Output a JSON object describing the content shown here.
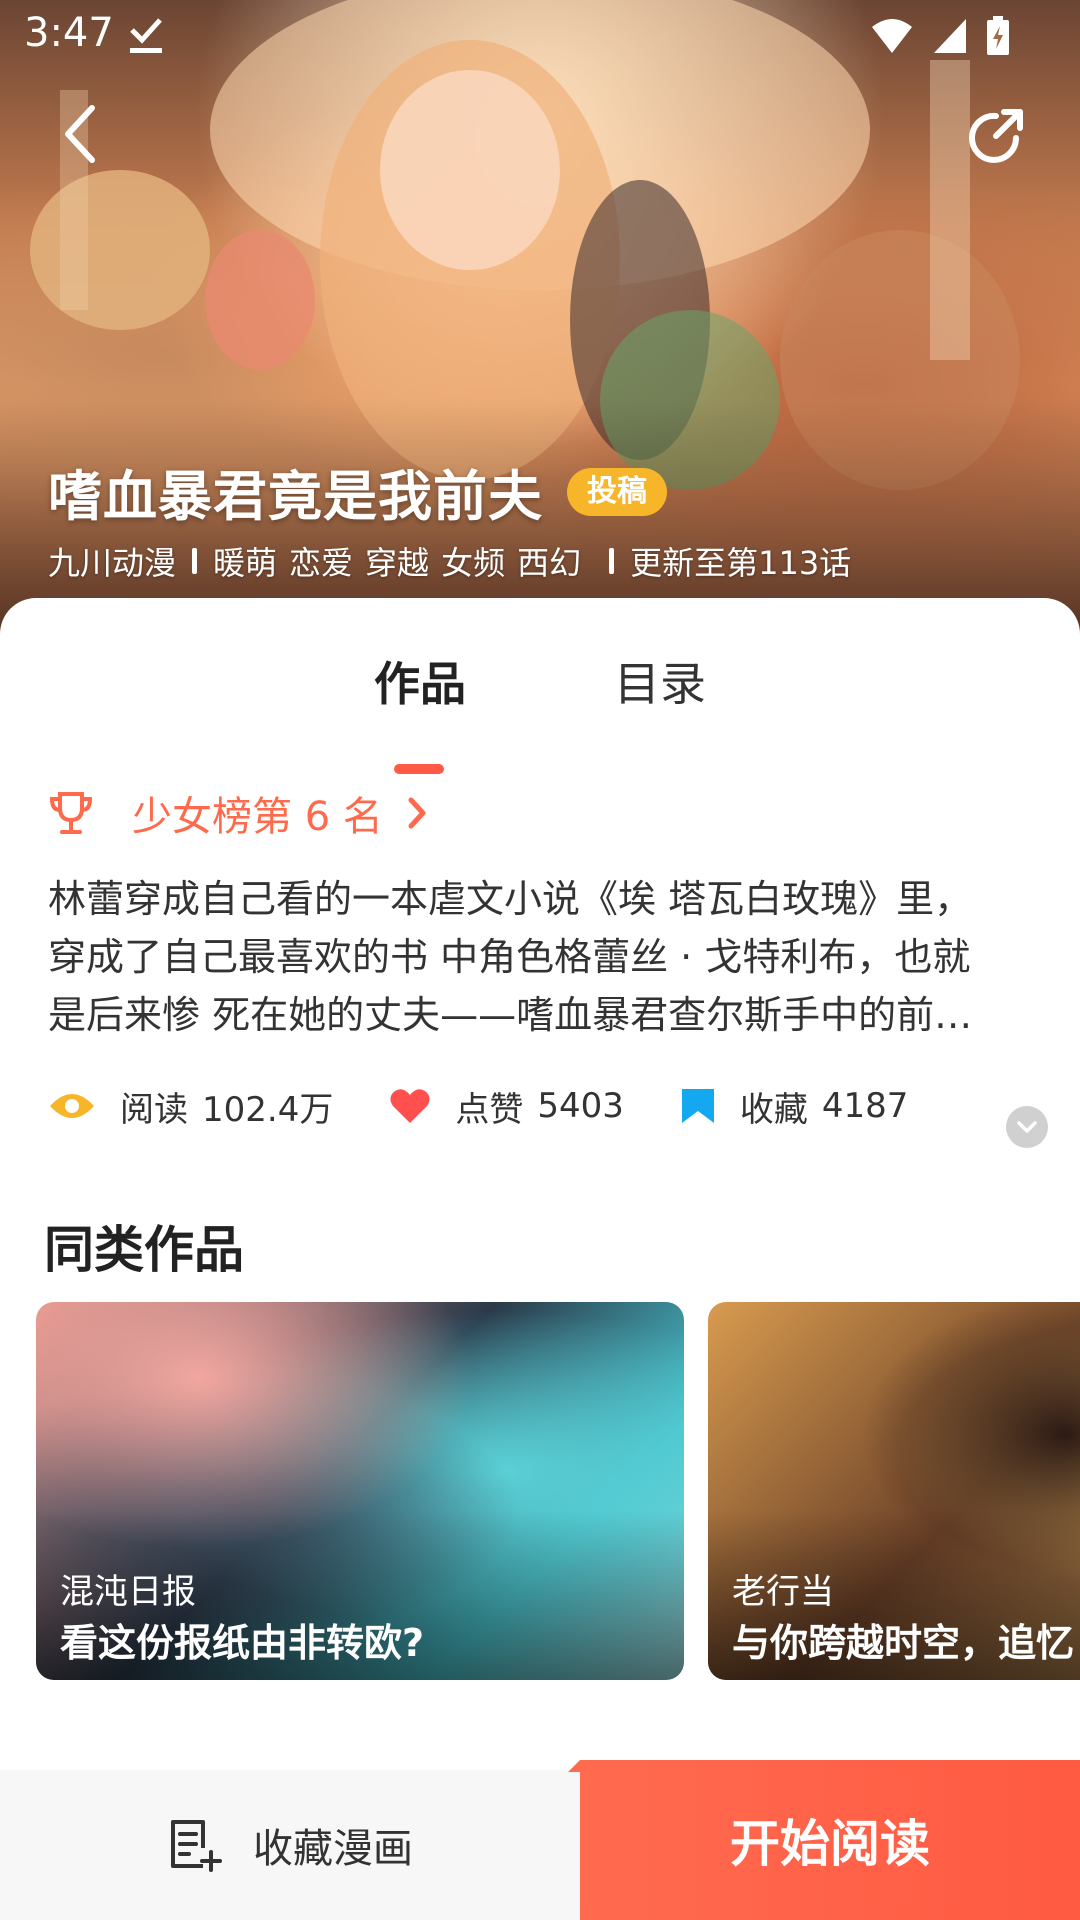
{
  "status_bar": {
    "time": "3:47"
  },
  "header": {
    "title": "嗜血暴君竟是我前夫",
    "badge": "投稿",
    "author": "九川动漫",
    "tags": [
      "暖萌",
      "恋爱",
      "穿越",
      "女频",
      "西幻"
    ],
    "update": "更新至第113话"
  },
  "tabs": [
    {
      "label": "作品",
      "selected": true
    },
    {
      "label": "目录",
      "selected": false
    }
  ],
  "rank": {
    "label": "少女榜第 6 名"
  },
  "description": "林蕾穿成自己看的一本虐文小说《埃 塔瓦白玫瑰》里，穿成了自己最喜欢的书 中角色格蕾丝 · 戈特利布，也就是后来惨 死在她的丈夫——嗜血暴君查尔斯手中的前妻……",
  "stats": [
    {
      "icon": "eye-icon",
      "label": "阅读",
      "value": "102.4万",
      "color": "#f7b629"
    },
    {
      "icon": "heart-icon",
      "label": "点赞",
      "value": "5403",
      "color": "#ff4f4f"
    },
    {
      "icon": "bookmark-icon",
      "label": "收藏",
      "value": "4187",
      "color": "#14a8f0"
    }
  ],
  "similar": {
    "title": "同类作品",
    "items": [
      {
        "subtitle": "混沌日报",
        "title": "看这份报纸由非转欧?"
      },
      {
        "subtitle": "老行当",
        "title": "与你跨越时空，追忆"
      }
    ]
  },
  "bottom_bar": {
    "collect_label": "收藏漫画",
    "read_label": "开始阅读"
  },
  "colors": {
    "accent": "#ff5a45",
    "badge": "#f7b629"
  }
}
